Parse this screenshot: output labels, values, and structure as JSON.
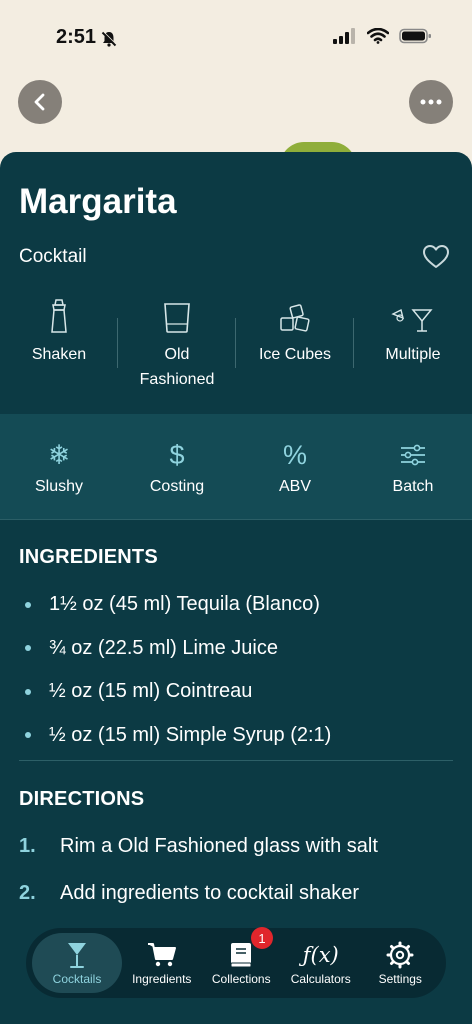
{
  "status": {
    "time": "2:51"
  },
  "recipe": {
    "title": "Margarita",
    "category": "Cocktail"
  },
  "properties": [
    {
      "icon": "shaker-icon",
      "label": "Shaken"
    },
    {
      "icon": "old-fashioned-glass-icon",
      "label": "Old Fashioned"
    },
    {
      "icon": "ice-cubes-icon",
      "label": "Ice Cubes"
    },
    {
      "icon": "garnish-glass-icon",
      "label": "Multiple"
    }
  ],
  "tools": [
    {
      "icon": "snowflake-icon",
      "label": "Slushy"
    },
    {
      "icon": "dollar-icon",
      "label": "Costing"
    },
    {
      "icon": "percent-icon",
      "label": "ABV"
    },
    {
      "icon": "sliders-icon",
      "label": "Batch"
    }
  ],
  "ingredients_heading": "INGREDIENTS",
  "ingredients": [
    "1½ oz (45 ml) Tequila (Blanco)",
    "¾ oz (22.5 ml) Lime Juice",
    "½ oz (15 ml) Cointreau",
    "½ oz (15 ml) Simple Syrup (2:1)"
  ],
  "directions_heading": "DIRECTIONS",
  "directions": [
    {
      "num": "1.",
      "text": "Rim a Old Fashioned glass with salt"
    },
    {
      "num": "2.",
      "text": "Add ingredients to cocktail shaker"
    }
  ],
  "tabbar": {
    "tabs": [
      {
        "label": "Cocktails",
        "icon": "cocktail-glass-icon",
        "active": true
      },
      {
        "label": "Ingredients",
        "icon": "cart-icon"
      },
      {
        "label": "Collections",
        "icon": "book-icon",
        "badge": "1"
      },
      {
        "label": "Calculators",
        "icon": "function-icon",
        "glyph": "ƒ(x)"
      },
      {
        "label": "Settings",
        "icon": "gear-icon"
      }
    ]
  },
  "colors": {
    "sheet": "#0c3a44",
    "tools_band": "#144b55",
    "accent": "#8fd3de",
    "badge": "#e0262c",
    "hero_bg": "#f3ede1"
  }
}
